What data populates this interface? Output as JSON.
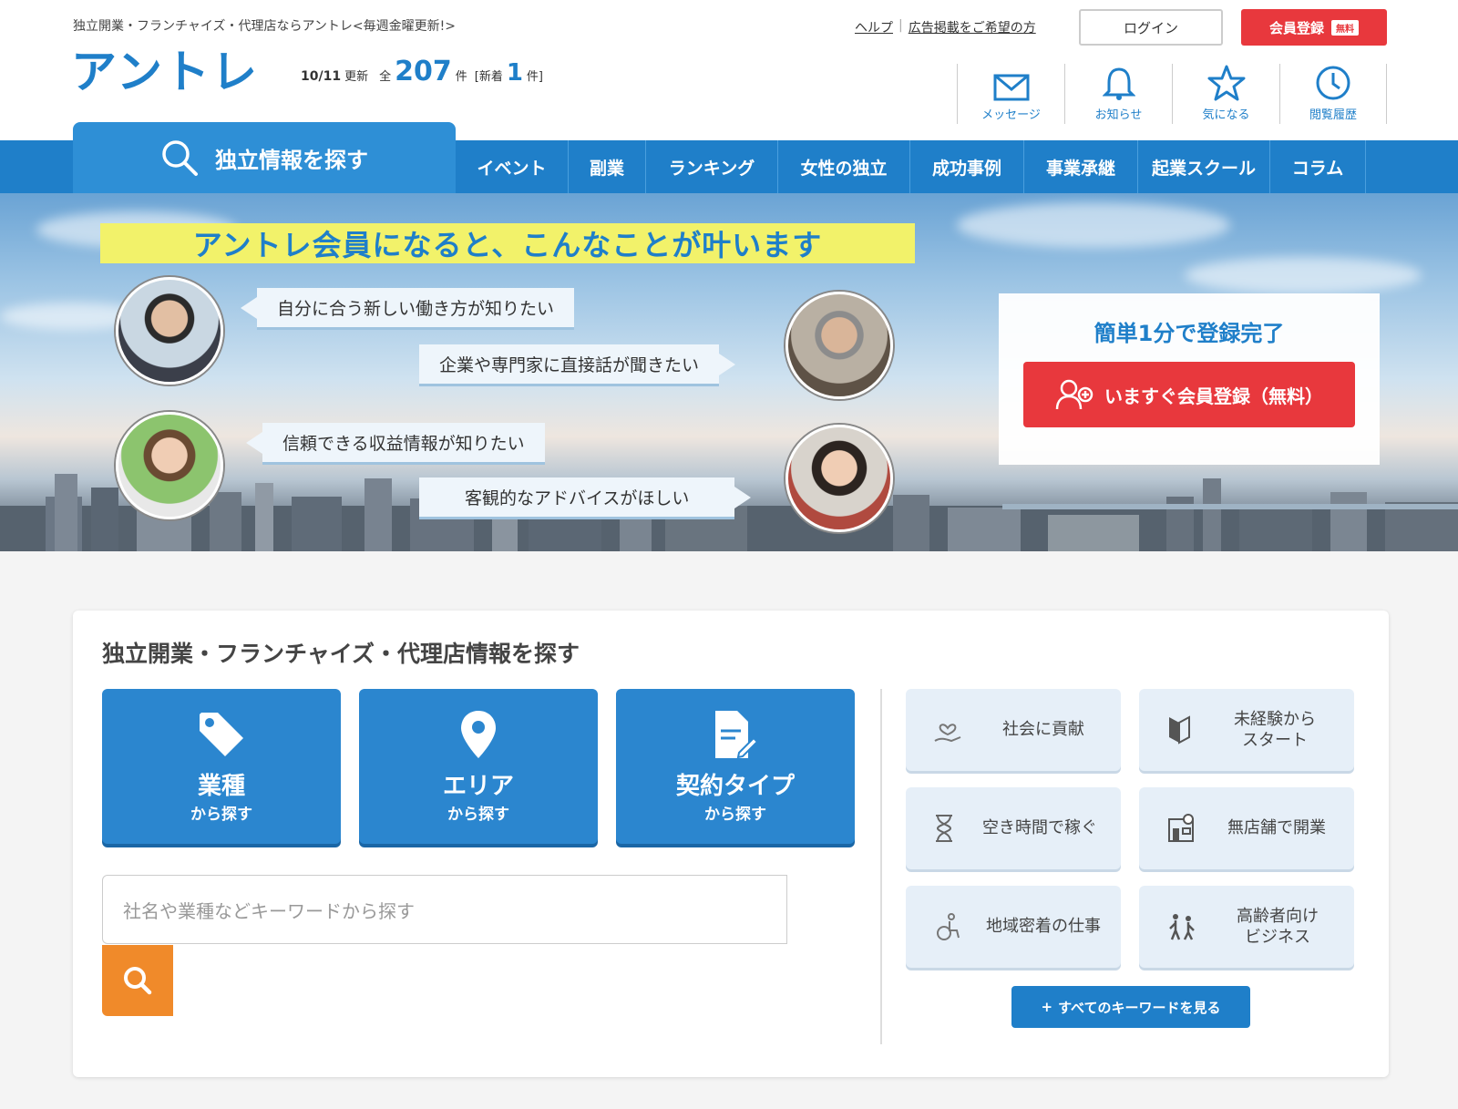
{
  "header": {
    "tagline": "独立開業・フランチャイズ・代理店ならアントレ<毎週金曜更新!>",
    "logo": "アントレ",
    "update_date": "10/11",
    "update_suffix": "更新",
    "total_prefix": "全",
    "total_count": "207",
    "total_unit": "件",
    "new_prefix": "[新着",
    "new_count": "1",
    "new_unit": "件]",
    "links": [
      "ヘルプ",
      "広告掲載をご希望の方"
    ],
    "link_sep": "|",
    "login": "ログイン",
    "register": "会員登録",
    "register_badge": "無料",
    "icon_nav": [
      {
        "label": "メッセージ",
        "icon": "envelope-icon"
      },
      {
        "label": "お知らせ",
        "icon": "bell-icon"
      },
      {
        "label": "気になる",
        "icon": "star-icon"
      },
      {
        "label": "閲覧履歴",
        "icon": "clock-icon"
      }
    ]
  },
  "nav": {
    "search_tab": "独立情報を探す",
    "items": [
      "イベント",
      "副業",
      "ランキング",
      "女性の独立",
      "成功事例",
      "事業承継",
      "起業スクール",
      "コラム"
    ]
  },
  "hero": {
    "title": "アントレ会員になると、こんなことが叶います",
    "bubbles": [
      "自分に合う新しい働き方が知りたい",
      "企業や専門家に直接話が聞きたい",
      "信頼できる収益情報が知りたい",
      "客観的なアドバイスがほしい"
    ],
    "register_box": {
      "title": "簡単1分で登録完了",
      "button": "いますぐ会員登録（無料）"
    }
  },
  "search": {
    "title": "独立開業・フランチャイズ・代理店情報を探す",
    "big_buttons": [
      {
        "main": "業種",
        "sub": "から探す",
        "icon": "tag-icon"
      },
      {
        "main": "エリア",
        "sub": "から探す",
        "icon": "map-pin-icon"
      },
      {
        "main": "契約タイプ",
        "sub": "から探す",
        "icon": "document-edit-icon"
      }
    ],
    "keyword_placeholder": "社名や業種などキーワードから探す",
    "tags": [
      {
        "label": "社会に貢献",
        "icon": "heart-hand-icon"
      },
      {
        "label": "未経験から\nスタート",
        "icon": "beginner-mark-icon"
      },
      {
        "label": "空き時間で稼ぐ",
        "icon": "hourglass-icon"
      },
      {
        "label": "無店舗で開業",
        "icon": "shop-icon"
      },
      {
        "label": "地域密着の仕事",
        "icon": "wheelchair-icon"
      },
      {
        "label": "高齢者向け\nビジネス",
        "icon": "elderly-icon"
      }
    ],
    "all_keywords": "すべてのキーワードを見る",
    "all_keywords_prefix": "+"
  },
  "colors": {
    "primary": "#1f7fc9",
    "accent_red": "#e8383d",
    "accent_orange": "#f08a2a",
    "highlight_yellow": "#f2f26a"
  }
}
